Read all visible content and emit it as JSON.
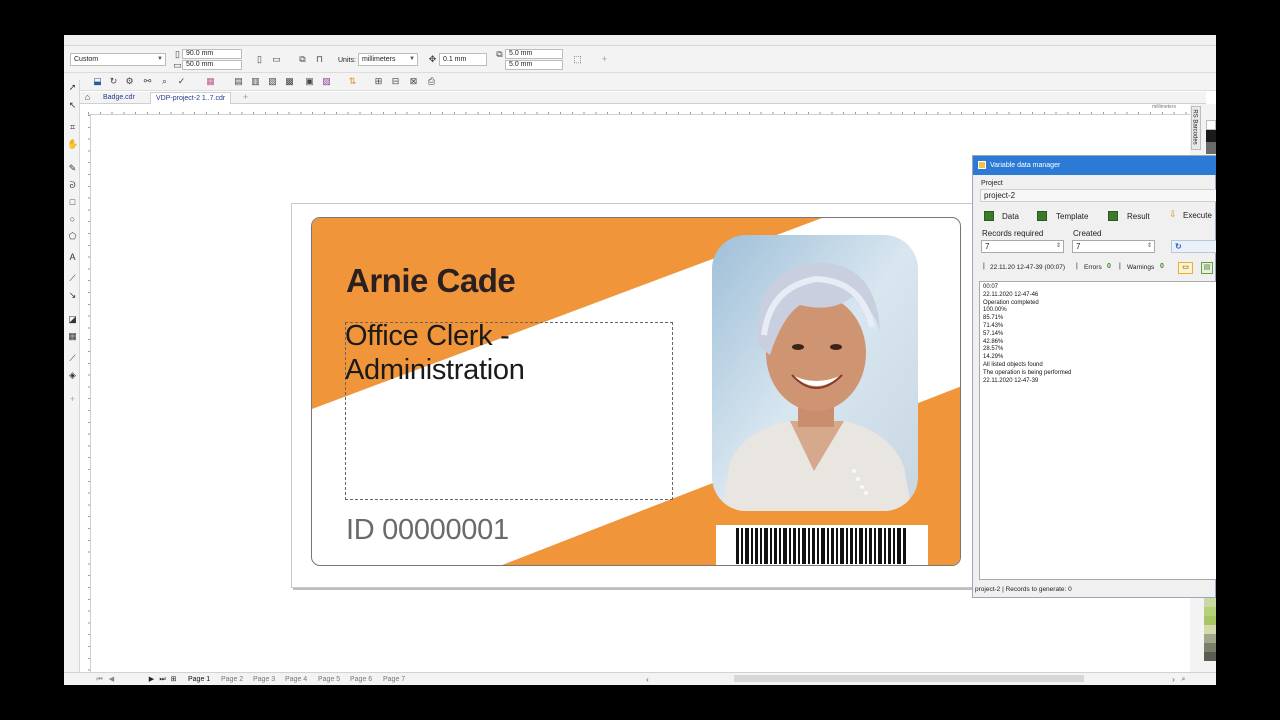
{
  "toolbar": {
    "page_size": "Custom",
    "width": "90.0 mm",
    "height": "50.0 mm",
    "units_label": "Units:",
    "units_value": "millimeters",
    "nudge": "0.1 mm",
    "dup_x": "5.0 mm",
    "dup_y": "5.0 mm",
    "add_icon": "+"
  },
  "doc_tabs": [
    {
      "label": "Badge.cdr"
    },
    {
      "label": "VDP-project-2 1..7.cdr"
    }
  ],
  "ruler": {
    "unit": "millimeters"
  },
  "badge": {
    "name": "Arnie Cade",
    "role_line1": "Office Clerk -",
    "role_line2": "Administration",
    "id": "ID 00000001",
    "accent_color": "#f0953a"
  },
  "page_tabs": [
    "Page 1",
    "Page 2",
    "Page 3",
    "Page 4",
    "Page 5",
    "Page 6",
    "Page 7"
  ],
  "side_panel": {
    "tab_label": "RS Barcodes"
  },
  "vdp": {
    "title": "Variable data manager",
    "project_label": "Project",
    "project_value": "project-2",
    "tabs": [
      "Data",
      "Template",
      "Result",
      "Execute"
    ],
    "records_required_label": "Records required",
    "records_required_value": "7",
    "created_label": "Created",
    "created_value": "7",
    "timestamp": "22.11.20 12-47-39 (00:07)",
    "errors_label": "Errors",
    "errors_value": "0",
    "warnings_label": "Warnings",
    "warnings_value": "0",
    "log": [
      "00:07",
      "22.11.2020 12-47-46",
      "Operation completed",
      "100.00%",
      "85.71%",
      "71.43%",
      "57.14%",
      "42.86%",
      "28.57%",
      "14.29%",
      "All listed objects found",
      "The operation is being performed",
      "22.11.2020 12-47-39"
    ],
    "status": "project-2 | Records to generate: 0"
  }
}
